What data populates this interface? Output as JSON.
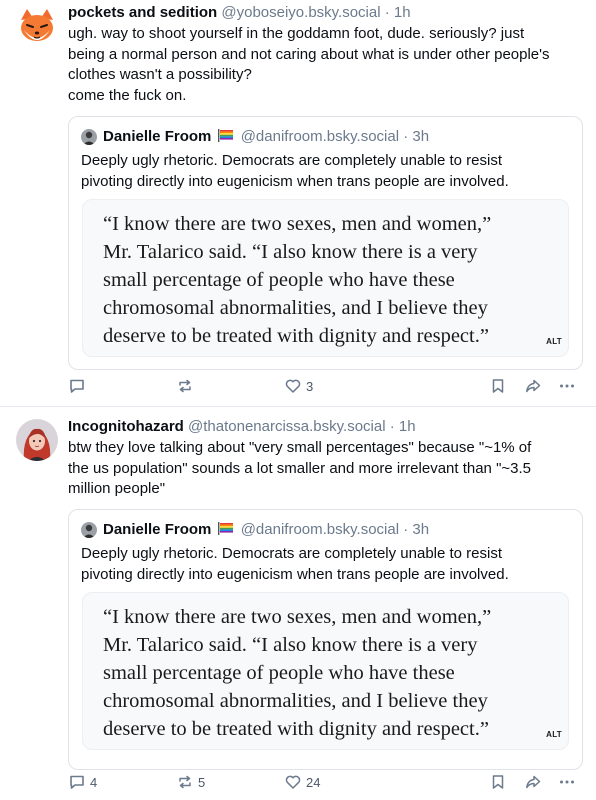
{
  "posts": [
    {
      "author": {
        "name": "pockets and sedition",
        "handle": "@yoboseiyo.bsky.social",
        "time": "1h",
        "avatar_icon": "fox-avatar-icon"
      },
      "body_lines": [
        "ugh. way to shoot yourself in the goddamn foot, dude. seriously? just",
        "being a normal person and not caring about what is under other people's",
        "clothes wasn't a possibility?",
        "come the fuck on."
      ],
      "quote": {
        "author": {
          "name": "Danielle Froom",
          "handle": "@danifroom.bsky.social",
          "time": "3h",
          "flag_icon": "rainbow-flag-icon"
        },
        "text_lines": [
          "Deeply ugly rhetoric. Democrats are completely unable to resist",
          "pivoting directly into eugenicism when trans people are involved."
        ],
        "image": {
          "lines": [
            "“I know there are two sexes, men and women,”",
            "Mr. Talarico said. “I also know there is a very",
            "small percentage of people who have these",
            "chromosomal abnormalities, and I believe they",
            "deserve to be treated with dignity and respect.”"
          ],
          "alt_badge": "ALT"
        }
      },
      "actions": {
        "replies": "",
        "reposts": "",
        "likes": "3"
      }
    },
    {
      "author": {
        "name": "Incognitohazard",
        "handle": "@thatonenarcissa.bsky.social",
        "time": "1h",
        "avatar_icon": "red-hair-avatar-icon"
      },
      "body_lines": [
        "btw they love talking about \"very small percentages\" because \"~1% of",
        "the us population\" sounds a lot smaller and more irrelevant than \"~3.5",
        "million people\""
      ],
      "quote": {
        "author": {
          "name": "Danielle Froom",
          "handle": "@danifroom.bsky.social",
          "time": "3h",
          "flag_icon": "rainbow-flag-icon"
        },
        "text_lines": [
          "Deeply ugly rhetoric. Democrats are completely unable to resist",
          "pivoting directly into eugenicism when trans people are involved."
        ],
        "image": {
          "lines": [
            "“I know there are two sexes, men and women,”",
            "Mr. Talarico said. “I also know there is a very",
            "small percentage of people who have these",
            "chromosomal abnormalities, and I believe they",
            "deserve to be treated with dignity and respect.”"
          ],
          "alt_badge": "ALT"
        }
      },
      "actions": {
        "replies": "4",
        "reposts": "5",
        "likes": "24"
      }
    }
  ],
  "separator": "·",
  "colors": {
    "text": "#0b0f14",
    "muted": "#6b7a8c",
    "border": "#dfe3e8"
  }
}
